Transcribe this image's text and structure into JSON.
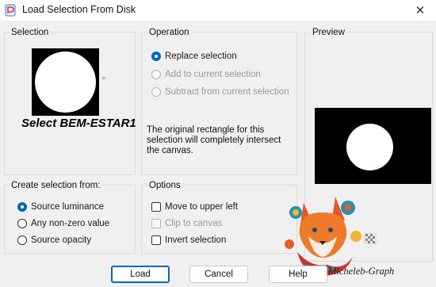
{
  "window": {
    "title": "Load Selection From Disk",
    "close_glyph": "✕"
  },
  "selection": {
    "group_label": "Selection",
    "selected_name": "Select BEM-ESTAR1"
  },
  "operation": {
    "group_label": "Operation",
    "options": [
      {
        "label": "Replace selection",
        "checked": true,
        "enabled": true
      },
      {
        "label": "Add to current selection",
        "checked": false,
        "enabled": false
      },
      {
        "label": "Subtract from current selection",
        "checked": false,
        "enabled": false
      }
    ],
    "info_text": "The original rectangle for this selection will completely intersect the canvas."
  },
  "preview": {
    "group_label": "Preview"
  },
  "create_from": {
    "group_label": "Create selection from:",
    "options": [
      {
        "label": "Source luminance",
        "checked": true
      },
      {
        "label": "Any non-zero value",
        "checked": false
      },
      {
        "label": "Source opacity",
        "checked": false
      }
    ]
  },
  "options": {
    "group_label": "Options",
    "items": [
      {
        "label": "Move to upper left",
        "checked": false,
        "enabled": true
      },
      {
        "label": "Clip to canvas",
        "checked": false,
        "enabled": false
      },
      {
        "label": "Invert selection",
        "checked": false,
        "enabled": true
      }
    ]
  },
  "buttons": {
    "load": "Load",
    "cancel": "Cancel",
    "help": "Help"
  },
  "watermark": {
    "text": "Micheleb-Graph"
  },
  "colors": {
    "accent": "#0067c0",
    "window_bg": "#f0f0f0",
    "titlebar_bg": "#ffffff"
  }
}
